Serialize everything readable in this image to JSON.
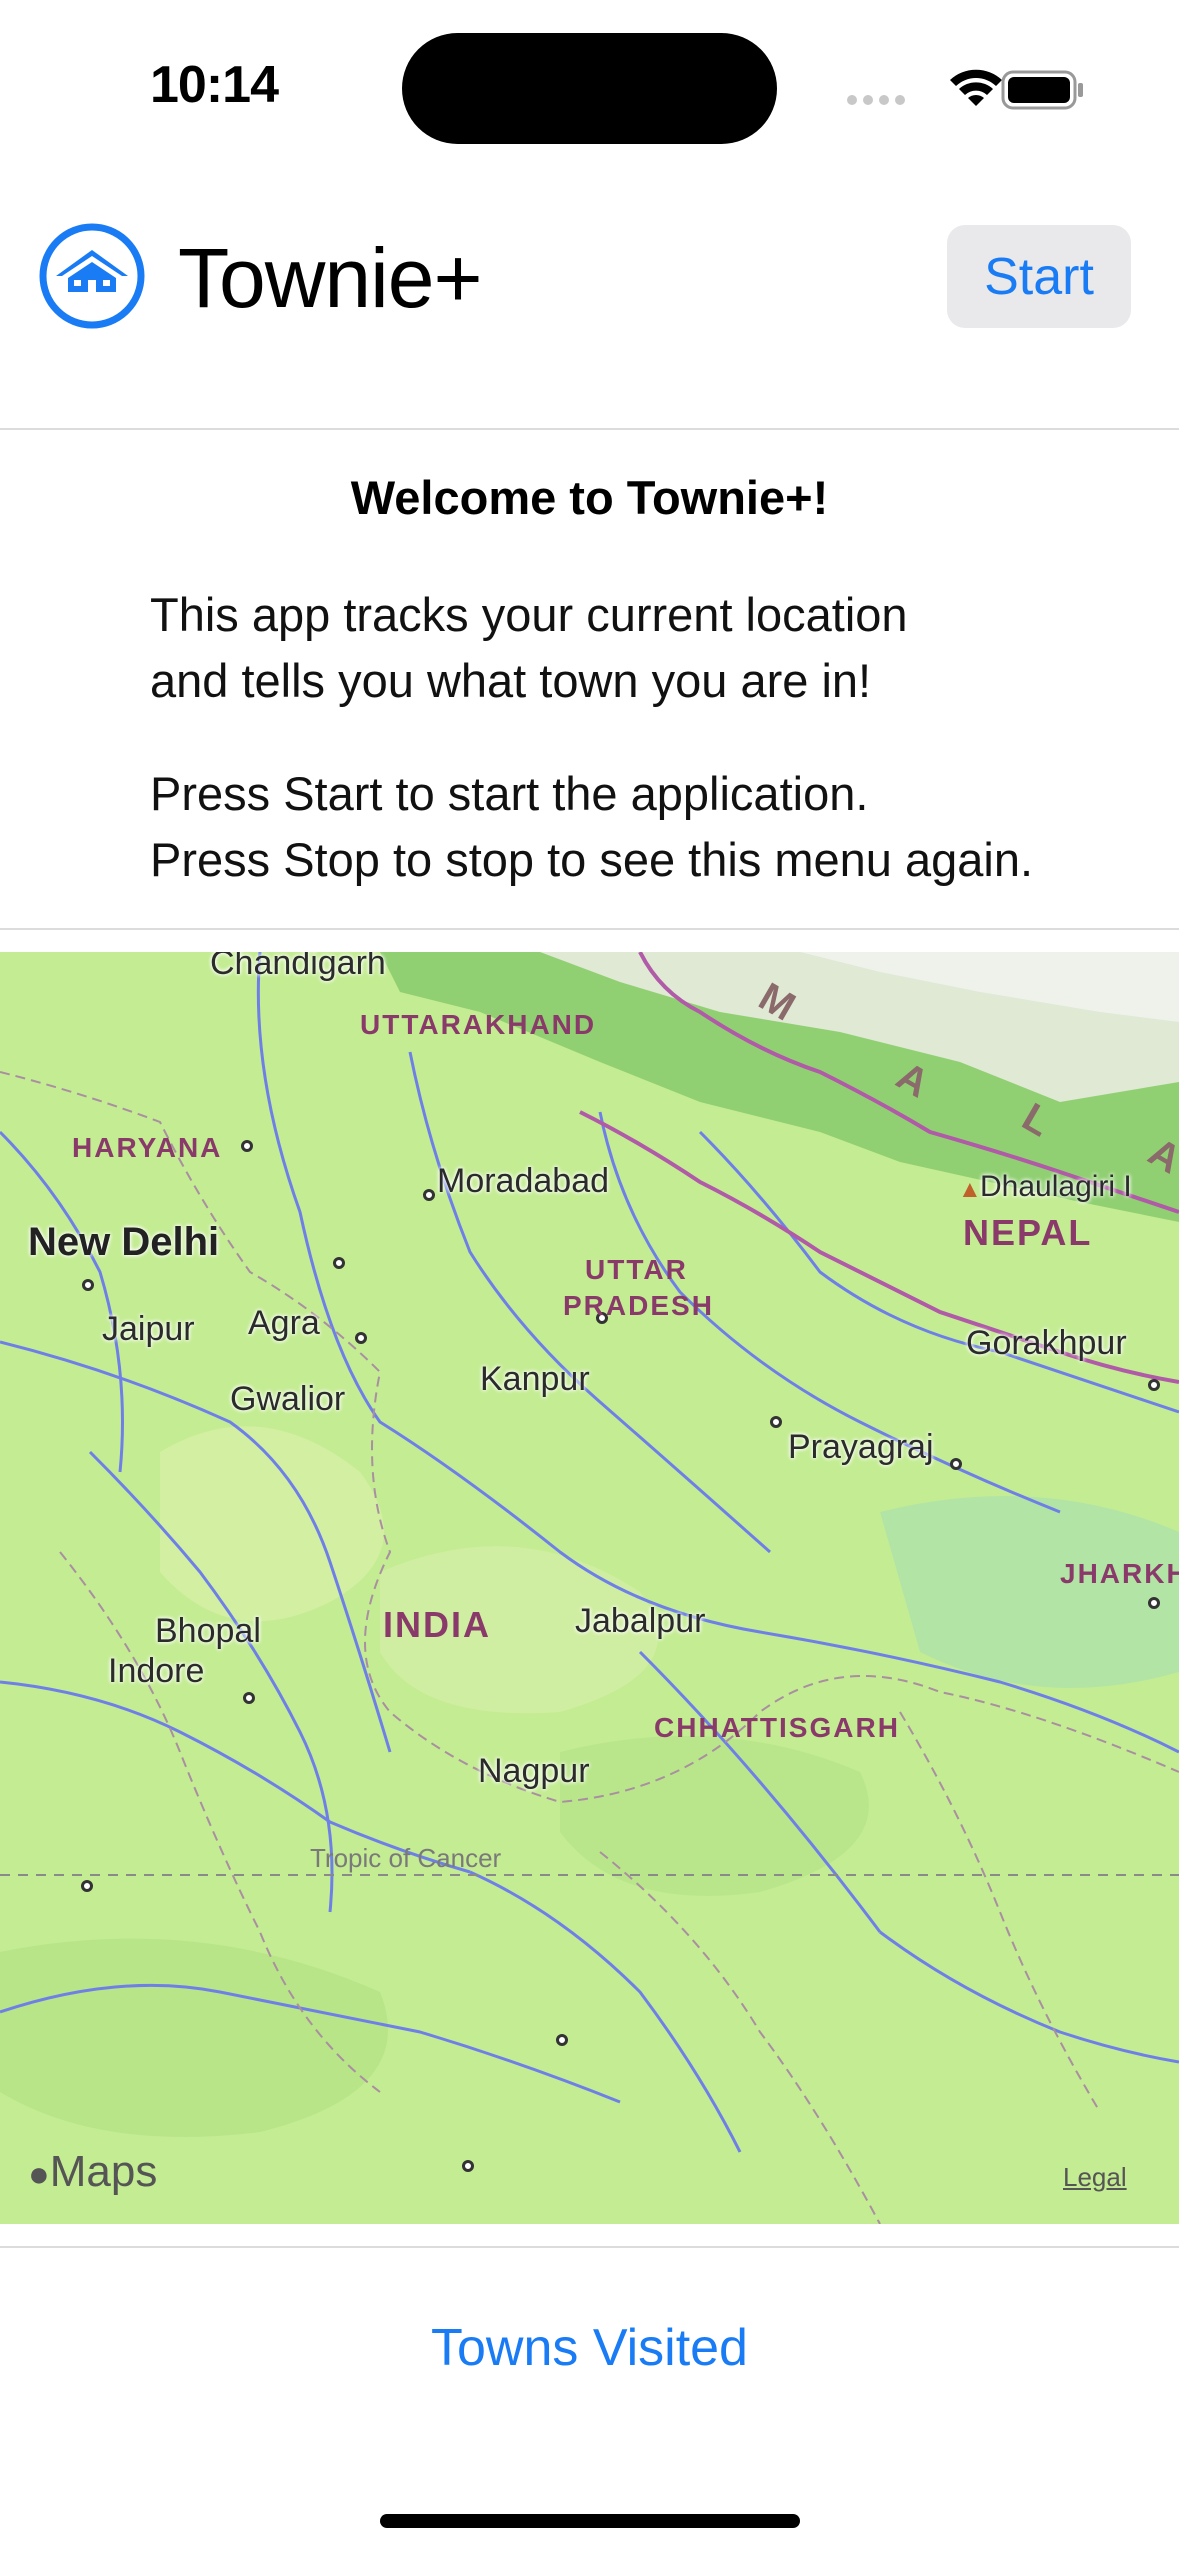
{
  "status_bar": {
    "time": "10:14"
  },
  "header": {
    "app_title": "Townie+",
    "start_label": "Start"
  },
  "welcome": {
    "title": "Welcome to Townie+!",
    "para1": [
      "This app tracks your current location",
      "and tells you what town you are in!"
    ],
    "para2": [
      "Press Start to start the application.",
      "Press Stop to stop to see this menu again."
    ]
  },
  "map": {
    "cities": [
      "Chandigarh",
      "Moradabad",
      "New Delhi",
      "Jaipur",
      "Agra",
      "Gwalior",
      "Kanpur",
      "Prayagraj",
      "Gorakhpur",
      "Bhopal",
      "Jabalpur",
      "Indore",
      "Nagpur"
    ],
    "peak": "Dhaulagiri I",
    "states": [
      "UTTARAKHAND",
      "HARYANA",
      "UTTAR",
      "PRADESH",
      "CHHATTISGARH",
      "JHARKH"
    ],
    "countries": [
      "NEPAL",
      "INDIA"
    ],
    "range_letters": [
      "M",
      "A",
      "L",
      "A"
    ],
    "tropic": "Tropic of Cancer",
    "brand": "Maps",
    "legal": "Legal",
    "colors": {
      "land": "#c4ec93",
      "mountain": "#e8efe0",
      "rivers": "#6f7fe8",
      "border": "#b05aa8"
    }
  },
  "footer": {
    "towns_visited_label": "Towns Visited"
  },
  "accent_color": "#1a7cf4"
}
